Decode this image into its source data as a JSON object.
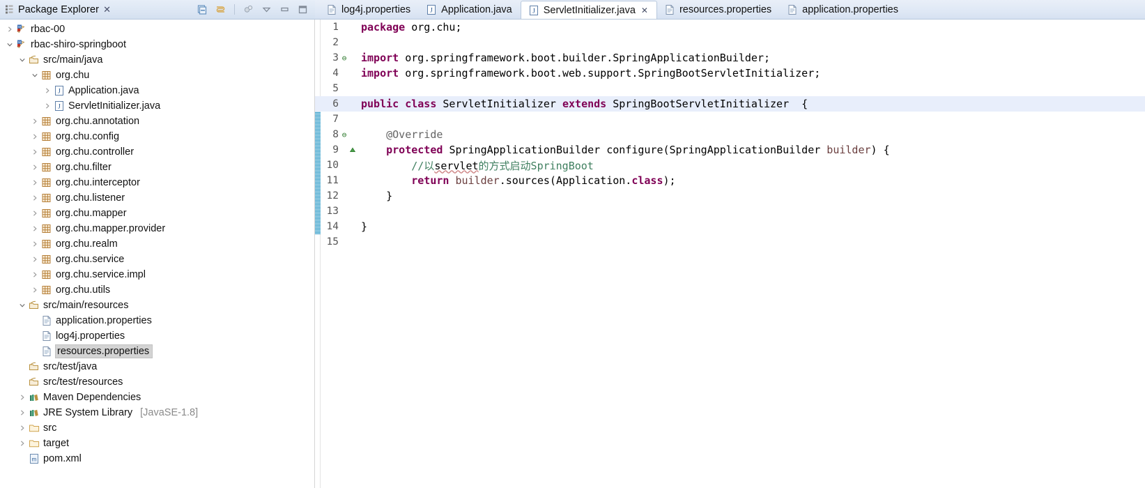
{
  "explorer": {
    "title": "Package Explorer",
    "close_glyph": "✕",
    "toolbar": [
      {
        "name": "link-with-editor-icon",
        "glyph": "▤"
      },
      {
        "name": "collapse-all-icon",
        "glyph": "⇄"
      },
      {
        "name": "focus-on-active-task-icon",
        "glyph": "⚇"
      },
      {
        "name": "view-menu-icon",
        "glyph": "▽"
      },
      {
        "name": "minimize-view-icon",
        "glyph": "▭"
      },
      {
        "name": "maximize-view-icon",
        "glyph": "❐"
      }
    ],
    "tree": [
      {
        "label": "rbac-00",
        "indent": 0,
        "twisty": "collapsed",
        "icon": "maven-project-icon",
        "selected": false
      },
      {
        "label": "rbac-shiro-springboot",
        "indent": 0,
        "twisty": "expanded",
        "icon": "maven-project-icon",
        "selected": false
      },
      {
        "label": "src/main/java",
        "indent": 1,
        "twisty": "expanded",
        "icon": "source-folder-icon",
        "selected": false
      },
      {
        "label": "org.chu",
        "indent": 2,
        "twisty": "expanded",
        "icon": "package-icon",
        "selected": false
      },
      {
        "label": "Application.java",
        "indent": 3,
        "twisty": "collapsed",
        "icon": "java-file-icon",
        "selected": false
      },
      {
        "label": "ServletInitializer.java",
        "indent": 3,
        "twisty": "collapsed",
        "icon": "java-file-icon",
        "selected": false
      },
      {
        "label": "org.chu.annotation",
        "indent": 2,
        "twisty": "collapsed",
        "icon": "package-icon",
        "selected": false
      },
      {
        "label": "org.chu.config",
        "indent": 2,
        "twisty": "collapsed",
        "icon": "package-icon",
        "selected": false
      },
      {
        "label": "org.chu.controller",
        "indent": 2,
        "twisty": "collapsed",
        "icon": "package-icon",
        "selected": false
      },
      {
        "label": "org.chu.filter",
        "indent": 2,
        "twisty": "collapsed",
        "icon": "package-icon",
        "selected": false
      },
      {
        "label": "org.chu.interceptor",
        "indent": 2,
        "twisty": "collapsed",
        "icon": "package-icon",
        "selected": false
      },
      {
        "label": "org.chu.listener",
        "indent": 2,
        "twisty": "collapsed",
        "icon": "package-icon",
        "selected": false
      },
      {
        "label": "org.chu.mapper",
        "indent": 2,
        "twisty": "collapsed",
        "icon": "package-icon",
        "selected": false
      },
      {
        "label": "org.chu.mapper.provider",
        "indent": 2,
        "twisty": "collapsed",
        "icon": "package-icon",
        "selected": false
      },
      {
        "label": "org.chu.realm",
        "indent": 2,
        "twisty": "collapsed",
        "icon": "package-icon",
        "selected": false
      },
      {
        "label": "org.chu.service",
        "indent": 2,
        "twisty": "collapsed",
        "icon": "package-icon",
        "selected": false
      },
      {
        "label": "org.chu.service.impl",
        "indent": 2,
        "twisty": "collapsed",
        "icon": "package-icon",
        "selected": false
      },
      {
        "label": "org.chu.utils",
        "indent": 2,
        "twisty": "collapsed",
        "icon": "package-icon",
        "selected": false
      },
      {
        "label": "src/main/resources",
        "indent": 1,
        "twisty": "expanded",
        "icon": "source-folder-icon",
        "selected": false
      },
      {
        "label": "application.properties",
        "indent": 2,
        "twisty": "none",
        "icon": "properties-file-icon",
        "selected": false
      },
      {
        "label": "log4j.properties",
        "indent": 2,
        "twisty": "none",
        "icon": "properties-file-icon",
        "selected": false
      },
      {
        "label": "resources.properties",
        "indent": 2,
        "twisty": "none",
        "icon": "properties-file-icon",
        "selected": true
      },
      {
        "label": "src/test/java",
        "indent": 1,
        "twisty": "none",
        "icon": "source-folder-icon",
        "selected": false
      },
      {
        "label": "src/test/resources",
        "indent": 1,
        "twisty": "none",
        "icon": "source-folder-icon",
        "selected": false
      },
      {
        "label": "Maven Dependencies",
        "indent": 1,
        "twisty": "collapsed",
        "icon": "library-icon",
        "selected": false
      },
      {
        "label": "JRE System Library",
        "indent": 1,
        "twisty": "collapsed",
        "icon": "library-icon",
        "selected": false,
        "sublabel": "[JavaSE-1.8]"
      },
      {
        "label": "src",
        "indent": 1,
        "twisty": "collapsed",
        "icon": "folder-icon",
        "selected": false
      },
      {
        "label": "target",
        "indent": 1,
        "twisty": "collapsed",
        "icon": "folder-icon",
        "selected": false
      },
      {
        "label": "pom.xml",
        "indent": 1,
        "twisty": "none",
        "icon": "maven-pom-icon",
        "selected": false
      }
    ]
  },
  "editor": {
    "tabs": [
      {
        "label": "log4j.properties",
        "icon": "properties-file-icon",
        "active": false,
        "closable": false
      },
      {
        "label": "Application.java",
        "icon": "java-file-icon",
        "active": false,
        "closable": false
      },
      {
        "label": "ServletInitializer.java",
        "icon": "java-file-icon",
        "active": true,
        "closable": true,
        "close_glyph": "✕"
      },
      {
        "label": "resources.properties",
        "icon": "properties-file-icon",
        "active": false,
        "closable": false
      },
      {
        "label": "application.properties",
        "icon": "properties-file-icon",
        "active": false,
        "closable": false
      }
    ],
    "change_bar_from_line": 6,
    "change_bar_to_line": 14,
    "highlight_line": 6,
    "lines": [
      {
        "n": "1",
        "fold": "",
        "marker": "",
        "hl": false,
        "tokens": [
          {
            "t": "package ",
            "c": "kw"
          },
          {
            "t": "org.chu;",
            "c": "plain"
          }
        ]
      },
      {
        "n": "2",
        "fold": "",
        "marker": "",
        "hl": false,
        "tokens": []
      },
      {
        "n": "3",
        "fold": "⊖",
        "marker": "",
        "hl": false,
        "tokens": [
          {
            "t": "import ",
            "c": "kw"
          },
          {
            "t": "org.springframework.boot.builder.SpringApplicationBuilder;",
            "c": "plain"
          }
        ]
      },
      {
        "n": "4",
        "fold": "",
        "marker": "",
        "hl": false,
        "tokens": [
          {
            "t": "import ",
            "c": "kw"
          },
          {
            "t": "org.springframework.boot.web.support.SpringBootServletInitializer;",
            "c": "plain"
          }
        ]
      },
      {
        "n": "5",
        "fold": "",
        "marker": "",
        "hl": false,
        "tokens": []
      },
      {
        "n": "6",
        "fold": "",
        "marker": "",
        "hl": true,
        "tokens": [
          {
            "t": "public class ",
            "c": "kw"
          },
          {
            "t": "ServletInitializer ",
            "c": "plain"
          },
          {
            "t": "extends ",
            "c": "kw"
          },
          {
            "t": "SpringBootServletInitializer  {",
            "c": "plain"
          }
        ]
      },
      {
        "n": "7",
        "fold": "",
        "marker": "",
        "hl": false,
        "tokens": []
      },
      {
        "n": "8",
        "fold": "⊖",
        "marker": "",
        "hl": false,
        "tokens": [
          {
            "t": "    @Override",
            "c": "ann"
          }
        ]
      },
      {
        "n": "9",
        "fold": "",
        "marker": "override-indicator",
        "hl": false,
        "tokens": [
          {
            "t": "    ",
            "c": "plain"
          },
          {
            "t": "protected ",
            "c": "kw"
          },
          {
            "t": "SpringApplicationBuilder configure(SpringApplicationBuilder ",
            "c": "plain"
          },
          {
            "t": "builder",
            "c": "loc"
          },
          {
            "t": ") {",
            "c": "plain"
          }
        ]
      },
      {
        "n": "10",
        "fold": "",
        "marker": "",
        "hl": false,
        "tokens": [
          {
            "t": "        //以",
            "c": "cmt"
          },
          {
            "t": "servlet",
            "c": "cmt-sq"
          },
          {
            "t": "的方式启动SpringBoot",
            "c": "cmt"
          }
        ]
      },
      {
        "n": "11",
        "fold": "",
        "marker": "",
        "hl": false,
        "tokens": [
          {
            "t": "        ",
            "c": "plain"
          },
          {
            "t": "return ",
            "c": "kw"
          },
          {
            "t": "builder",
            "c": "loc"
          },
          {
            "t": ".sources(Application.",
            "c": "plain"
          },
          {
            "t": "class",
            "c": "kw"
          },
          {
            "t": ");",
            "c": "plain"
          }
        ]
      },
      {
        "n": "12",
        "fold": "",
        "marker": "",
        "hl": false,
        "tokens": [
          {
            "t": "    }",
            "c": "plain"
          }
        ]
      },
      {
        "n": "13",
        "fold": "",
        "marker": "",
        "hl": false,
        "tokens": []
      },
      {
        "n": "14",
        "fold": "",
        "marker": "",
        "hl": false,
        "tokens": [
          {
            "t": "}",
            "c": "plain"
          }
        ]
      },
      {
        "n": "15",
        "fold": "",
        "marker": "",
        "hl": false,
        "tokens": []
      }
    ]
  },
  "colors": {
    "keyword": "#7f0055",
    "comment": "#3f7f5f",
    "annotation": "#646464",
    "local_var": "#6a3e3e",
    "line_highlight": "#e8eefb",
    "change_bar": "#7ec4df",
    "selection_bg": "#d3d3d3",
    "tab_active_bg": "#ffffff",
    "chrome_bg": "#dde7f4"
  }
}
